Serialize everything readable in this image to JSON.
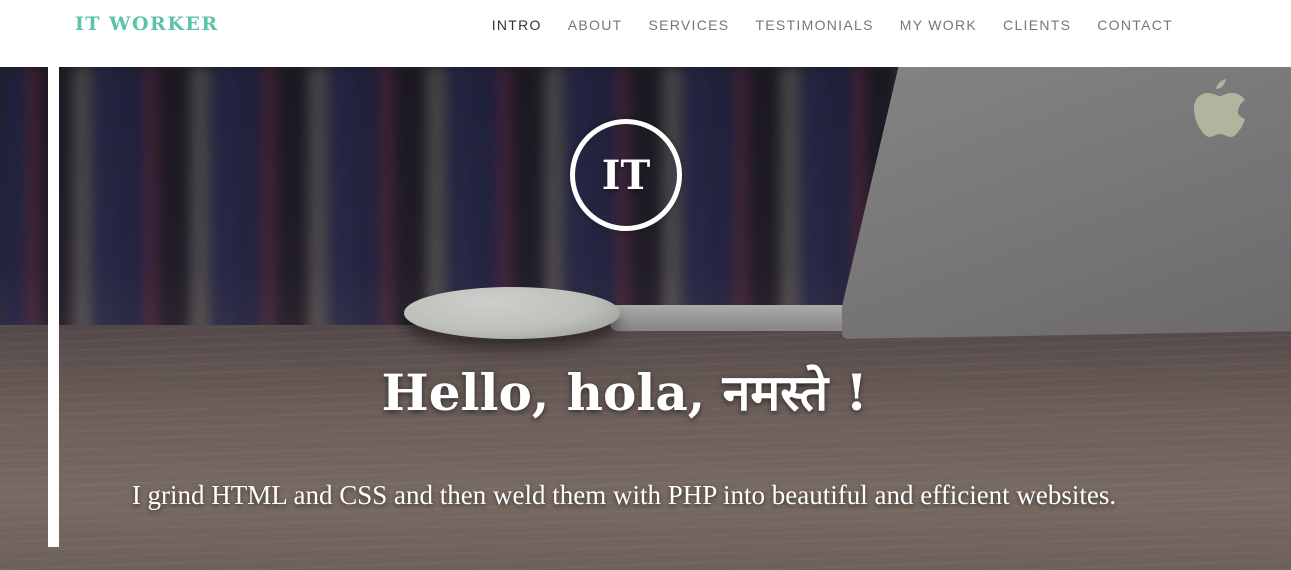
{
  "brand": {
    "name": "IT WORKER"
  },
  "nav": {
    "items": [
      {
        "label": "INTRO",
        "active": true
      },
      {
        "label": "ABOUT"
      },
      {
        "label": "SERVICES"
      },
      {
        "label": "TESTIMONIALS"
      },
      {
        "label": "MY WORK"
      },
      {
        "label": "CLIENTS"
      },
      {
        "label": "CONTACT"
      }
    ]
  },
  "hero": {
    "logo_text": "IT",
    "headline": "Hello, hola, नमस्ते !",
    "subline": "I grind HTML and CSS and then weld them with PHP into beautiful and efficient websites.",
    "background_image": "blurred bookshelf, white mouse and silver laptop on wooden desk"
  },
  "colors": {
    "brand_accent": "#5cc2a8",
    "nav_text": "#777777",
    "nav_active": "#333333",
    "hero_text": "#ffffff"
  }
}
